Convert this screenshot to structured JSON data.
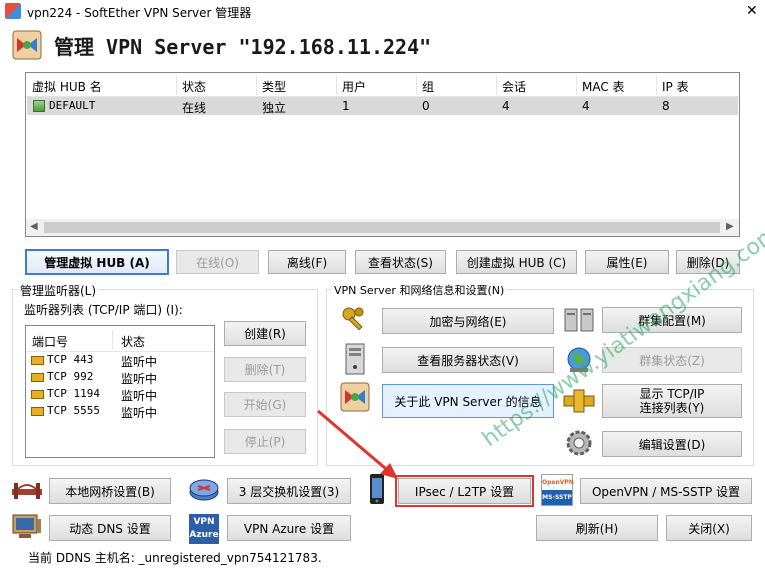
{
  "window": {
    "title": "vpn224 - SoftEther VPN Server 管理器",
    "close_glyph": "✕"
  },
  "header": {
    "title": "管理 VPN Server \"192.168.11.224\""
  },
  "hub_table": {
    "columns": [
      "虚拟 HUB 名",
      "状态",
      "类型",
      "用户",
      "组",
      "会话",
      "MAC 表",
      "IP 表"
    ],
    "rows": [
      {
        "name": "DEFAULT",
        "status": "在线",
        "type": "独立",
        "users": "1",
        "groups": "0",
        "sessions": "4",
        "mac": "4",
        "ip": "8"
      }
    ]
  },
  "hub_buttons": {
    "manage": "管理虚拟 HUB (A)",
    "online": "在线(O)",
    "offline": "离线(F)",
    "status": "查看状态(S)",
    "create": "创建虚拟 HUB (C)",
    "properties": "属性(E)",
    "delete": "删除(D)"
  },
  "listener": {
    "group_label": "管理监听器(L)",
    "list_label": "监听器列表 (TCP/IP 端口) (I):",
    "columns": [
      "端口号",
      "状态"
    ],
    "rows": [
      {
        "port": "TCP 443",
        "status": "监听中"
      },
      {
        "port": "TCP 992",
        "status": "监听中"
      },
      {
        "port": "TCP 1194",
        "status": "监听中"
      },
      {
        "port": "TCP 5555",
        "status": "监听中"
      }
    ],
    "buttons": {
      "create": "创建(R)",
      "delete": "删除(T)",
      "start": "开始(G)",
      "stop": "停止(P)"
    }
  },
  "server_info": {
    "group_label": "VPN Server 和网络信息和设置(N)",
    "encryption": "加密与网络(E)",
    "server_status": "查看服务器状态(V)",
    "about": "关于此 VPN Server 的信息",
    "cluster_config": "群集配置(M)",
    "cluster_status": "群集状态(Z)",
    "tcp_list_line1": "显示 TCP/IP",
    "tcp_list_line2": "连接列表(Y)",
    "edit_config": "编辑设置(D)"
  },
  "bottom": {
    "local_bridge": "本地网桥设置(B)",
    "l3_switch": "3 层交换机设置(3)",
    "ipsec": "IPsec / L2TP 设置",
    "openvpn": "OpenVPN / MS-SSTP 设置",
    "ddns": "动态 DNS 设置",
    "azure": "VPN Azure 设置",
    "refresh": "刷新(H)",
    "close": "关闭(X)",
    "ddns_status": "当前 DDNS 主机名: _unregistered_vpn754121783.",
    "vpn_badge_line1": "VPN",
    "vpn_badge_line2": "Azure",
    "openvpn_badge_line1": "OpenVPN",
    "openvpn_badge_line2": "MS-SSTP"
  },
  "watermark": {
    "text": "https://www.yiatiwangxiang.com"
  },
  "colors": {
    "accent_blue": "#3a7bd5",
    "selection": "#d9d9d9",
    "annotation_red": "#e0352b",
    "watermark_green": "#2aa864"
  }
}
